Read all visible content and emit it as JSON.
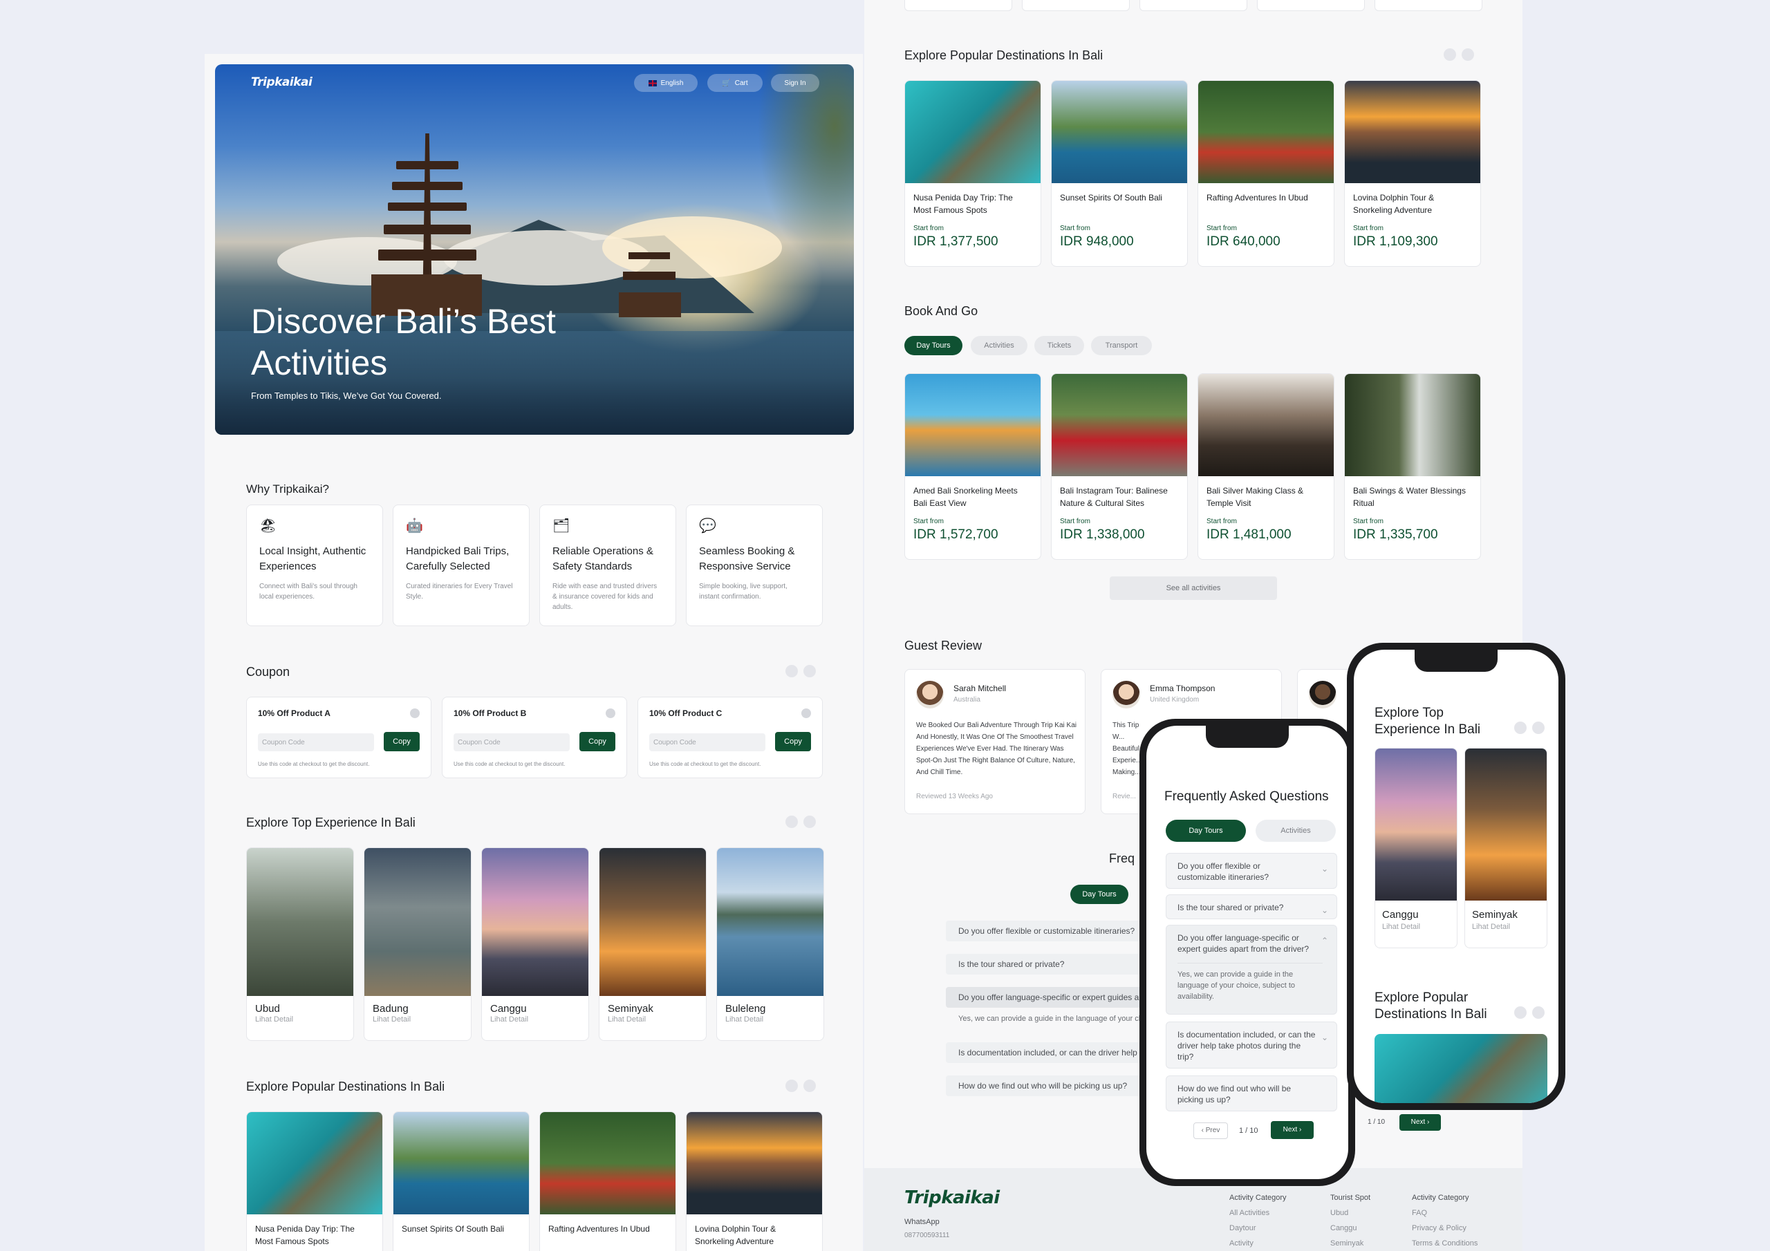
{
  "brand": "Tripkaikai",
  "hero": {
    "language": "English",
    "cart": "Cart",
    "sign_in": "Sign In",
    "title": "Discover Bali’s Best Activities",
    "subtitle": "From Temples to Tikis, We’ve Got You Covered."
  },
  "why": {
    "title": "Why Tripkaikai?",
    "items": [
      {
        "icon": "beach-umbrella-icon",
        "title": "Local Insight, Authentic Experiences",
        "desc": "Connect with Bali's soul through local experiences."
      },
      {
        "icon": "robot-icon",
        "title": "Handpicked Bali Trips, Carefully Selected",
        "desc": "Curated itineraries for Every Travel Style."
      },
      {
        "icon": "card-icon",
        "title": "Reliable Operations & Safety Standards",
        "desc": "Ride with ease and trusted drivers & insurance covered for kids and adults."
      },
      {
        "icon": "chat-icon",
        "title": "Seamless Booking & Responsive Service",
        "desc": "Simple booking, live support, instant confirmation."
      }
    ]
  },
  "coupon": {
    "title": "Coupon",
    "items": [
      {
        "name": "10% Off Product A",
        "placeholder": "Coupon Code",
        "button": "Copy",
        "note": "Use this code at checkout to get the discount."
      },
      {
        "name": "10% Off Product B",
        "placeholder": "Coupon Code",
        "button": "Copy",
        "note": "Use this code at checkout to get the discount."
      },
      {
        "name": "10% Off Product C",
        "placeholder": "Coupon Code",
        "button": "Copy",
        "note": "Use this code at checkout to get the discount."
      }
    ]
  },
  "top_experience": {
    "title": "Explore Top Experience In Bali",
    "items": [
      {
        "name": "Ubud",
        "link": "Lihat Detail"
      },
      {
        "name": "Badung",
        "link": "Lihat Detail"
      },
      {
        "name": "Canggu",
        "link": "Lihat Detail"
      },
      {
        "name": "Seminyak",
        "link": "Lihat Detail"
      },
      {
        "name": "Buleleng",
        "link": "Lihat Detail"
      }
    ]
  },
  "popular": {
    "title": "Explore Popular Destinations In Bali",
    "start_from": "Start from",
    "items": [
      {
        "name": "Nusa Penida Day Trip: The Most Famous Spots",
        "price": "IDR 1,377,500"
      },
      {
        "name": "Sunset Spirits Of South Bali",
        "price": "IDR 948,000"
      },
      {
        "name": "Rafting Adventures In Ubud",
        "price": "IDR 640,000"
      },
      {
        "name": "Lovina Dolphin Tour & Snorkeling Adventure",
        "price": "IDR 1,109,300"
      }
    ]
  },
  "book": {
    "title": "Book And Go",
    "tabs": [
      "Day Tours",
      "Activities",
      "Tickets",
      "Transport"
    ],
    "items": [
      {
        "name": "Amed Bali Snorkeling Meets Bali East View",
        "price": "IDR 1,572,700"
      },
      {
        "name": "Bali Instagram Tour: Balinese Nature & Cultural Sites",
        "price": "IDR 1,338,000"
      },
      {
        "name": "Bali Silver Making Class & Temple Visit",
        "price": "IDR 1,481,000"
      },
      {
        "name": "Bali Swings & Water Blessings Ritual",
        "price": "IDR 1,335,700"
      }
    ],
    "see_all": "See all activities"
  },
  "reviews": {
    "title": "Guest Review",
    "items": [
      {
        "name": "Sarah Mitchell",
        "country": "Australia",
        "text": "We Booked Our Bali Adventure Through Trip Kai Kai And Honestly, It Was One Of The Smoothest Travel Experiences We've Ever Had. The Itinerary Was Spot-On Just The Right Balance Of Culture, Nature, And Chill Time.",
        "date": "Reviewed 13 Weeks Ago"
      },
      {
        "name": "Emma Thompson",
        "country": "United Kingdom",
        "text": "This Trip W... Beautiful... Experie... Making...",
        "date": "Revie..."
      }
    ]
  },
  "faq": {
    "title": "Frequently Asked Questions",
    "tabs": [
      "Day Tours",
      "Activities"
    ],
    "questions": [
      "Do you offer flexible or customizable itineraries?",
      "Is the tour shared or private?",
      "Do you offer language-specific or expert guides apart from the driver?",
      "Is documentation included, or can the driver help take photos during the trip?",
      "How do we find out who will be picking us up?"
    ],
    "answer": "Yes, we can provide a guide in the language of your choice, subject to availability.",
    "pagination": {
      "prev": "Prev",
      "page": "1 / 10",
      "next": "Next"
    }
  },
  "footer": {
    "whatsapp_label": "WhatsApp",
    "whatsapp_number": "087700593111",
    "col1": {
      "title": "Activity Category",
      "items": [
        "All Activities",
        "Daytour",
        "Activity"
      ]
    },
    "col2": {
      "title": "Tourist Spot",
      "items": [
        "Ubud",
        "Canggu",
        "Seminyak"
      ]
    },
    "col3": {
      "title": "Activity Category",
      "items": [
        "FAQ",
        "Privacy & Policy",
        "Terms & Conditions"
      ]
    }
  },
  "mobile": {
    "top_title": "Explore Top Experience In Bali",
    "cards": [
      {
        "name": "Canggu",
        "link": "Lihat Detail"
      },
      {
        "name": "Seminyak",
        "link": "Lihat Detail"
      }
    ],
    "popular_title": "Explore Popular Destinations In Bali",
    "page": "1 / 10",
    "next": "Next"
  }
}
